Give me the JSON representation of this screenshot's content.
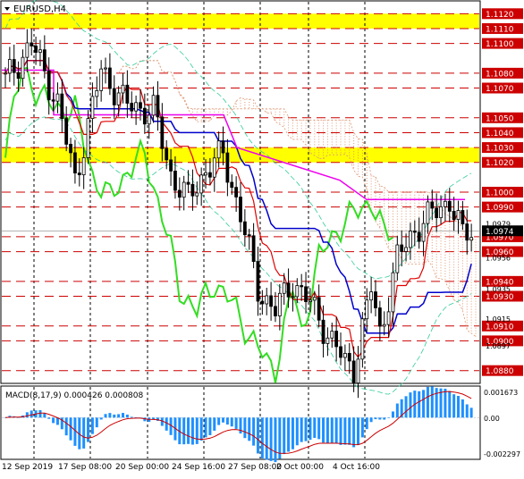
{
  "header": {
    "symbol_label": "EURUSD,H4",
    "indicator_label": "MACD(8,17,9) 0.000426 0.000808"
  },
  "colors": {
    "background": "#ffffff",
    "candles": "#000000",
    "resistance_line": "#cc0000",
    "highlight_zone": "#ffff00",
    "tenkan": "#e00000",
    "kijun": "#0000cc",
    "chikou": "#33dd22",
    "senkou_line": "#ee00ee",
    "bollinger": "#33cc99",
    "cloud_dots": "#dd9977",
    "macd_hist": "#1e90ff",
    "macd_signal": "#cc0000",
    "current_price_tag": "#000000",
    "level_tag": "#cc0000"
  },
  "chart_data": [
    {
      "type": "candlestick",
      "title": "EURUSD,H4",
      "x_tick_labels": [
        "12 Sep 2019",
        "17 Sep 08:00",
        "20 Sep 00:00",
        "24 Sep 16:00",
        "27 Sep 08:00",
        "2 Oct 00:00",
        "4 Oct 16:00"
      ],
      "ylim": [
        1.0872,
        1.1128
      ],
      "price_scale_labels": [
        "1.0979",
        "1.0976",
        "1.0956",
        "1.0935",
        "1.0915",
        "1.0897"
      ],
      "resistance_levels": [
        "1.1120",
        "1.1110",
        "1.1100",
        "1.1080",
        "1.1070",
        "1.1050",
        "1.1040",
        "1.1030",
        "1.1020",
        "1.1000",
        "1.0990",
        "1.0970",
        "1.0960",
        "1.0940",
        "1.0930",
        "1.0910",
        "1.0900",
        "1.0880"
      ],
      "highlight_zones": [
        [
          1.111,
          1.112
        ],
        [
          1.102,
          1.103
        ]
      ],
      "current_price": 1.0974,
      "ichimoku": {
        "senkou_line_level": 1.0995
      }
    },
    {
      "type": "histogram",
      "title": "MACD(8,17,9)",
      "main_value": 0.000426,
      "signal_value": 0.000808,
      "ylim": [
        -0.002297,
        0.001673
      ],
      "y_tick_labels": [
        "0.001673",
        "0.00",
        "-0.002297"
      ]
    }
  ]
}
